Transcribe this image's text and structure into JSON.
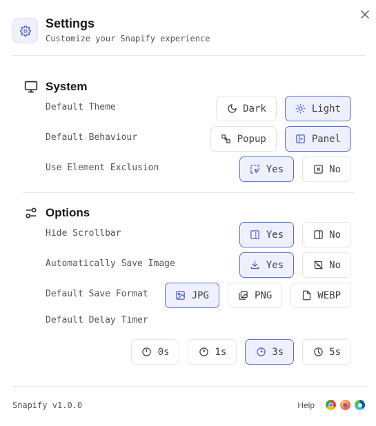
{
  "header": {
    "title": "Settings",
    "subtitle": "Customize your Snapify experience"
  },
  "system": {
    "title": "System",
    "theme": {
      "label": "Default Theme",
      "options": [
        {
          "label": "Dark",
          "icon": "moon-icon",
          "selected": false
        },
        {
          "label": "Light",
          "icon": "sun-icon",
          "selected": true
        }
      ]
    },
    "behaviour": {
      "label": "Default Behaviour",
      "options": [
        {
          "label": "Popup",
          "icon": "popup-icon",
          "selected": false
        },
        {
          "label": "Panel",
          "icon": "panel-icon",
          "selected": true
        }
      ]
    },
    "exclusion": {
      "label": "Use Element Exclusion",
      "options": [
        {
          "label": "Yes",
          "icon": "selection-pointer-icon",
          "selected": true
        },
        {
          "label": "No",
          "icon": "x-square-icon",
          "selected": false
        }
      ]
    }
  },
  "options": {
    "title": "Options",
    "scrollbar": {
      "label": "Hide Scrollbar",
      "options": [
        {
          "label": "Yes",
          "icon": "dashed-scrollbar-icon",
          "selected": true
        },
        {
          "label": "No",
          "icon": "scrollbar-icon",
          "selected": false
        }
      ]
    },
    "autosave": {
      "label": "Automatically Save Image",
      "options": [
        {
          "label": "Yes",
          "icon": "download-icon",
          "selected": true
        },
        {
          "label": "No",
          "icon": "no-save-icon",
          "selected": false
        }
      ]
    },
    "format": {
      "label": "Default Save Format",
      "options": [
        {
          "label": "JPG",
          "icon": "image-icon",
          "selected": true
        },
        {
          "label": "PNG",
          "icon": "images-icon",
          "selected": false
        },
        {
          "label": "WEBP",
          "icon": "file-icon",
          "selected": false
        }
      ]
    },
    "delay": {
      "label": "Default Delay Timer",
      "options": [
        {
          "label": "0s",
          "icon": "clock-icon",
          "selected": false
        },
        {
          "label": "1s",
          "icon": "clock-icon",
          "selected": false
        },
        {
          "label": "3s",
          "icon": "clock-icon",
          "selected": true
        },
        {
          "label": "5s",
          "icon": "clock-icon",
          "selected": false
        }
      ]
    }
  },
  "footer": {
    "version": "Snapify v1.0.0",
    "help": "Help",
    "browsers": [
      "chrome-icon",
      "firefox-icon",
      "edge-icon"
    ]
  },
  "colors": {
    "accent": "#5b6ee1",
    "accent_bg": "#eef1fd",
    "border": "#e4e4e7"
  }
}
